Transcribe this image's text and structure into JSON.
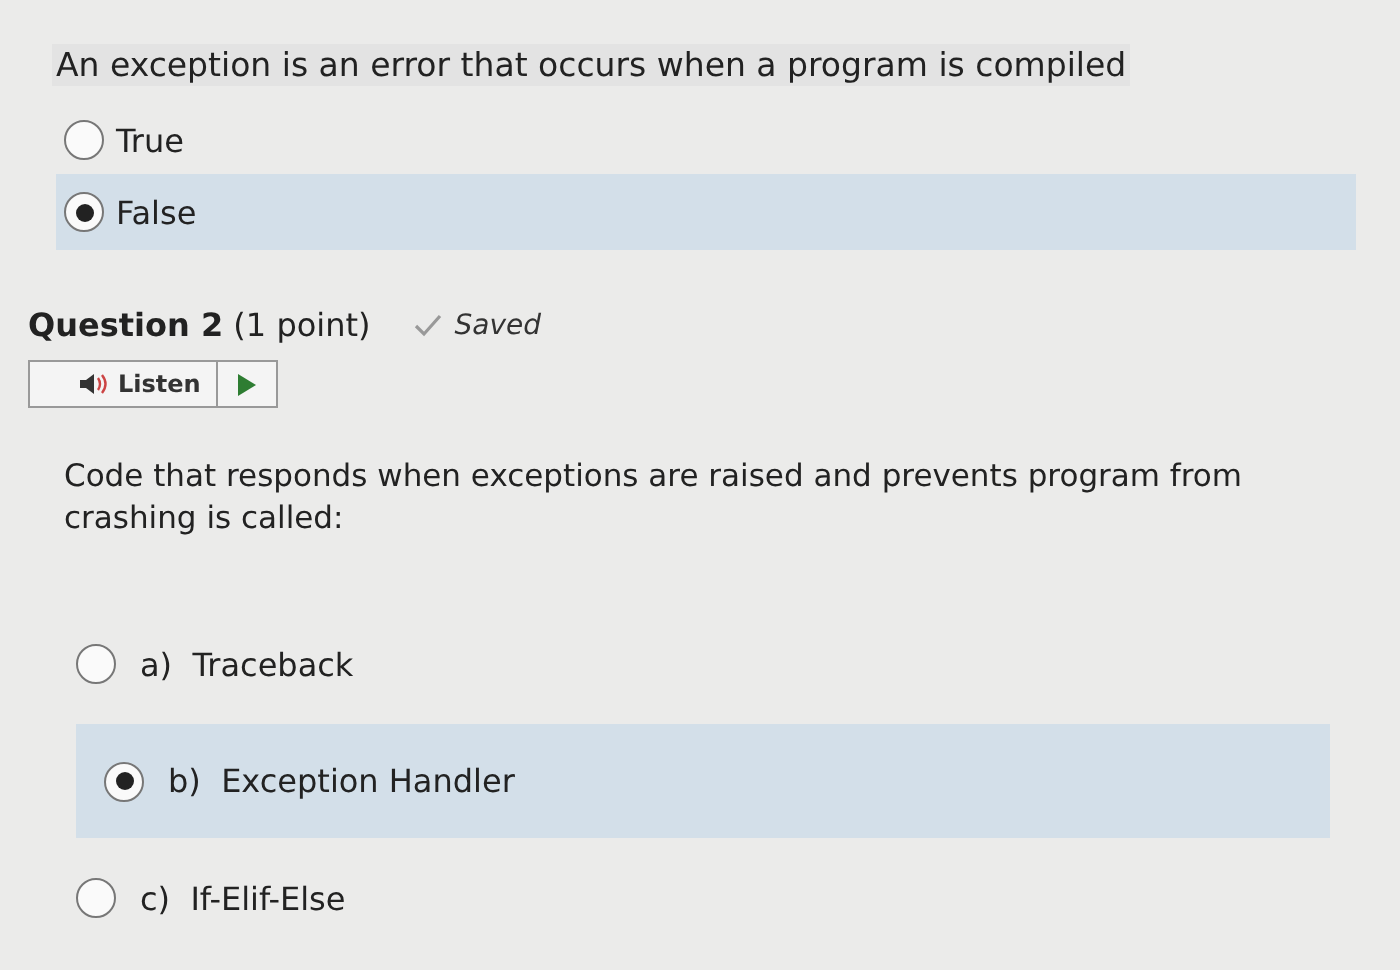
{
  "question_1": {
    "prompt": "An exception is an error that occurs when a program is compiled",
    "options": [
      {
        "label": "True",
        "selected": false
      },
      {
        "label": "False",
        "selected": true
      }
    ]
  },
  "question_2": {
    "title": "**Question 2** (1 point)",
    "status": "Saved",
    "listen_button": "Listen",
    "prompt": "Code that responds when exceptions are raised and prevents program from crashing is called:",
    "options": [
      {
        "letter": "a)",
        "label": "Traceback",
        "selected": false
      },
      {
        "letter": "b)",
        "label": "Exception Handler",
        "selected": true
      },
      {
        "letter": "c)",
        "label": "If-Elif-Else",
        "selected": false
      }
    ]
  }
}
